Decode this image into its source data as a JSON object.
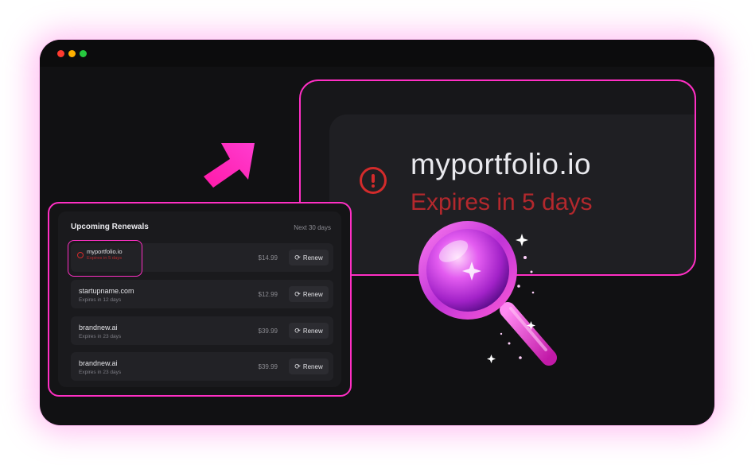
{
  "zoom": {
    "domain": "myportfolio.io",
    "expires": "Expires in 5 days",
    "alert_icon": "alert-circle-icon"
  },
  "card": {
    "title": "Upcoming Renewals",
    "period": "Next 30 days",
    "rows": [
      {
        "name": "myportfolio.io",
        "expires": "Expires in 5 days",
        "price": "$14.99",
        "button": "Renew"
      },
      {
        "name": "startupname.com",
        "expires": "Expires in 12 days",
        "price": "$12.99",
        "button": "Renew"
      },
      {
        "name": "brandnew.ai",
        "expires": "Expires in 23 days",
        "price": "$39.99",
        "button": "Renew"
      },
      {
        "name": "brandnew.ai",
        "expires": "Expires in 23 days",
        "price": "$39.99",
        "button": "Renew"
      }
    ]
  },
  "colors": {
    "accent": "#ff2fc4",
    "alert": "#d32b2b",
    "background": "#111113"
  },
  "icons": {
    "renew": "refresh-icon",
    "arrow": "arrow-up-right-icon",
    "magnifier": "magnifying-glass-icon"
  }
}
